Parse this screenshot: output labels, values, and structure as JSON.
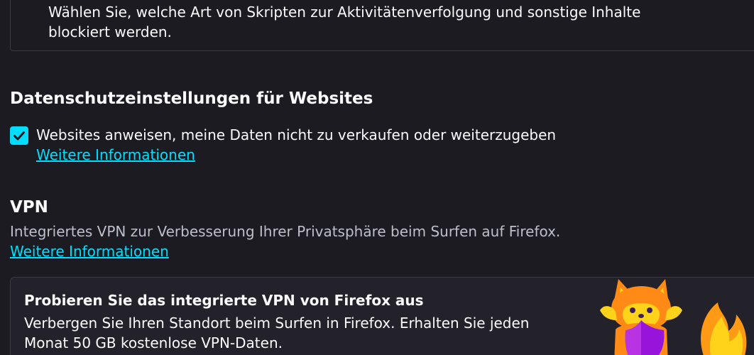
{
  "tracking": {
    "description": "Wählen Sie, welche Art von Skripten zur Aktivitätenverfolgung und sonstige Inhalte blockiert werden."
  },
  "website_privacy": {
    "title": "Datenschutzeinstellungen für Websites",
    "checkbox_label": "Websites anweisen, meine Daten nicht zu verkaufen oder weiterzugeben",
    "checkbox_checked": true,
    "more_info_link": "Weitere Informationen"
  },
  "vpn": {
    "title": "VPN",
    "description": "Integriertes VPN zur Verbesserung Ihrer Privatsphäre beim Surfen auf Firefox.",
    "more_info_link": "Weitere Informationen",
    "promo": {
      "title": "Probieren Sie das integrierte VPN von Firefox aus",
      "text": "Verbergen Sie Ihren Standort beim Surfen in Firefox. Erhalten Sie jeden Monat 50 GB kostenlose VPN-Daten."
    }
  },
  "colors": {
    "background": "#1c1b22",
    "accent": "#00ddff",
    "text": "#fbfbfe",
    "muted_text": "#bfbfc9"
  },
  "icons": {
    "checkbox": "checkmark-icon",
    "illustration": "fox-vpn-illustration"
  }
}
